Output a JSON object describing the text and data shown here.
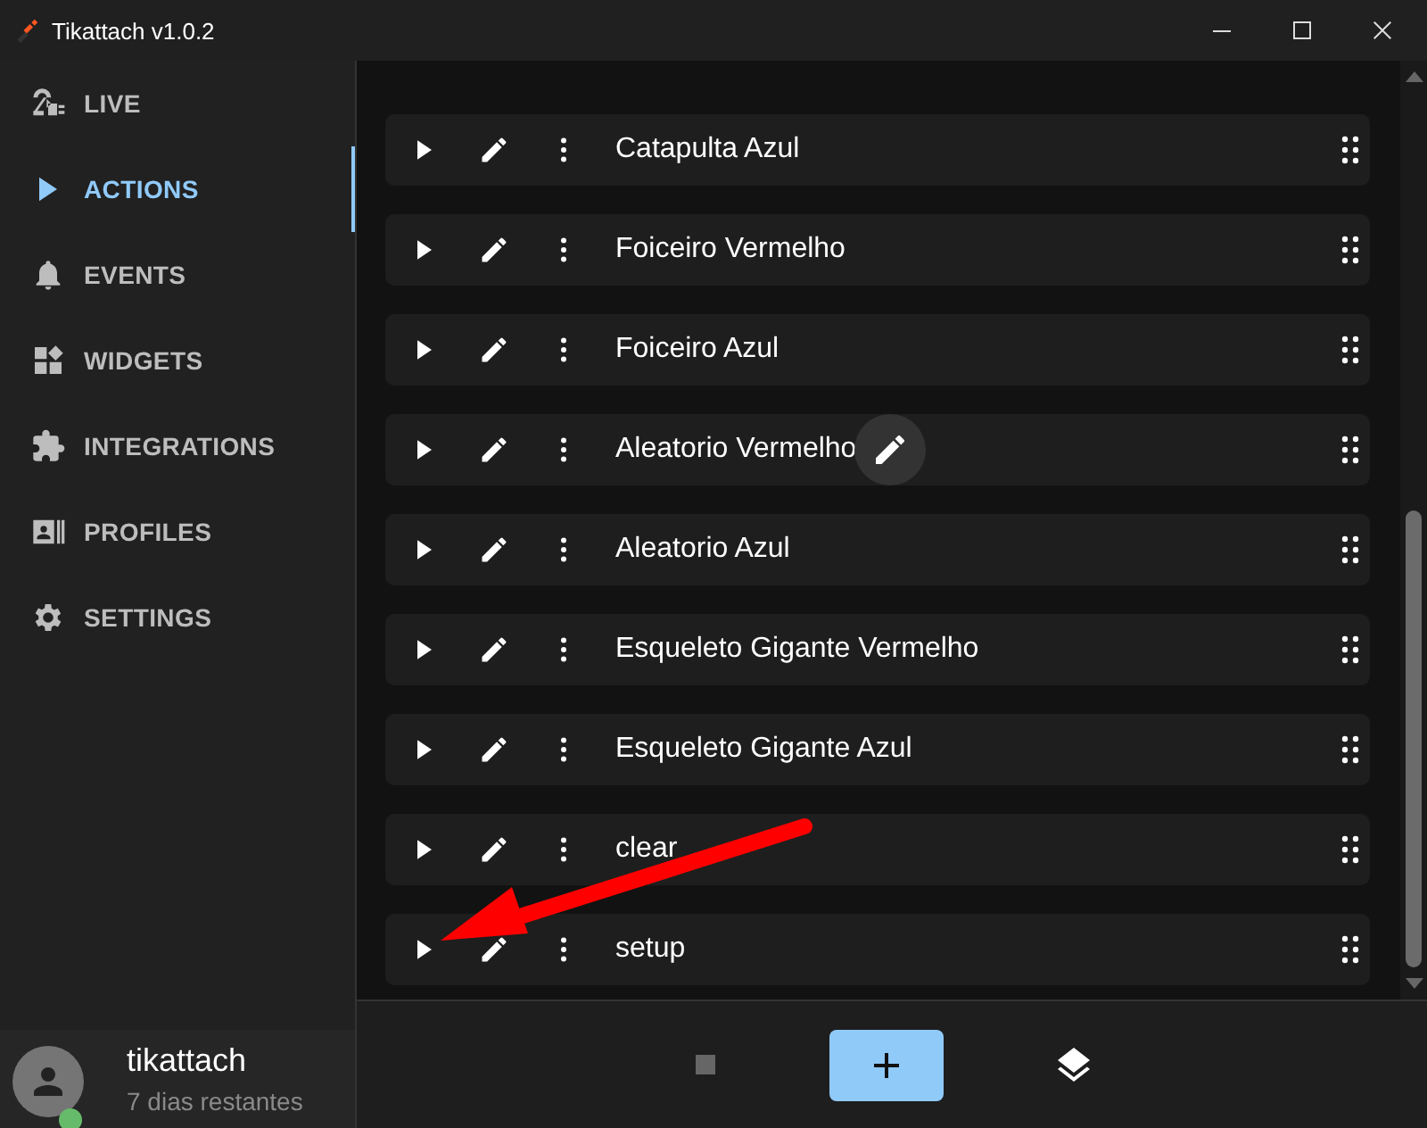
{
  "window": {
    "title": "Tikattach v1.0.2"
  },
  "sidebar": {
    "items": [
      {
        "label": "LIVE",
        "selected": false
      },
      {
        "label": "ACTIONS",
        "selected": true
      },
      {
        "label": "EVENTS",
        "selected": false
      },
      {
        "label": "WIDGETS",
        "selected": false
      },
      {
        "label": "INTEGRATIONS",
        "selected": false
      },
      {
        "label": "PROFILES",
        "selected": false
      },
      {
        "label": "SETTINGS",
        "selected": false
      }
    ],
    "user": {
      "name": "tikattach",
      "subtitle": "7 dias restantes",
      "online": true
    }
  },
  "actions": [
    {
      "name": "Catapulta Azul",
      "hovered": false
    },
    {
      "name": "Foiceiro Vermelho",
      "hovered": false
    },
    {
      "name": "Foiceiro Azul",
      "hovered": false
    },
    {
      "name": "Aleatorio Vermelho",
      "hovered": true
    },
    {
      "name": "Aleatorio Azul",
      "hovered": false
    },
    {
      "name": "Esqueleto Gigante Vermelho",
      "hovered": false
    },
    {
      "name": "Esqueleto Gigante Azul",
      "hovered": false
    },
    {
      "name": "clear",
      "hovered": false
    },
    {
      "name": "setup",
      "hovered": false
    }
  ],
  "annotation": {
    "kind": "arrow"
  }
}
